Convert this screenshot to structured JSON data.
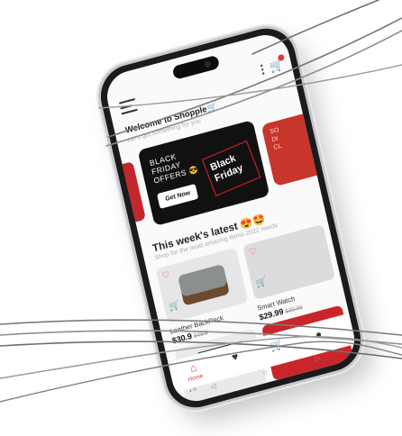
{
  "app": {
    "welcome": "Welcome to Shopple🛒",
    "welcome_sub": "Let's get something for you",
    "menu_dots": "⋮",
    "cart_icon": "🛒"
  },
  "banners": {
    "main": {
      "lines": [
        "BLACK",
        "FRIDAY",
        "OFFERS 😎"
      ],
      "button": "Get Now",
      "logo_lines": [
        "Black",
        "Friday"
      ]
    },
    "right": {
      "lines": [
        "SO",
        "DI",
        "CL"
      ]
    }
  },
  "section": {
    "title": "This week's latest 😍🤩",
    "subtitle": "Shop for the most amazing items 2022 needs"
  },
  "products": [
    {
      "name": "Leather BackPack",
      "price": "$30.9",
      "old_price": "$49.9"
    },
    {
      "name": "Smart Watch",
      "price": "$29.99",
      "old_price": "$39.99"
    },
    {
      "name": "",
      "price": "",
      "old_price": ""
    },
    {
      "name": "",
      "price": "",
      "old_price": ""
    }
  ],
  "bottom_nav": {
    "home_label": "Home",
    "home_icon": "⌂",
    "fav_icon": "♥",
    "cart_icon": "🛒",
    "profile_icon": "●"
  },
  "system_nav": {
    "back": "◁",
    "home": "○",
    "recent": "▷"
  },
  "colors": {
    "accent": "#e53935",
    "banner_dark": "#111111",
    "banner_red": "#c8352b"
  }
}
